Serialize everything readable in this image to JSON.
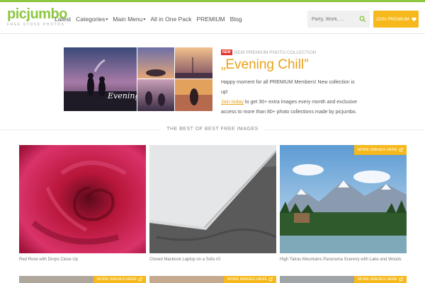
{
  "header": {
    "logo": "picjumbo",
    "tagline": "FREE STOCK PHOTOS",
    "nav": [
      "Latest",
      "Categories",
      "Main Menu",
      "All in One Pack",
      "PREMIUM",
      "Blog"
    ],
    "search_placeholder": "Party, Work, ...",
    "join_label": "JOIN PREMIUM"
  },
  "banner": {
    "badge": "NEW",
    "tag": "NEW PREMIUM PHOTO COLLECTION",
    "title": "„Evening Chill”",
    "text_1": "Happy moment for all PREMIUM Members! New collection is up!",
    "link": "Join today",
    "text_2": " to get 30+ extra images every month and exclusive access to more than 80+ photo collections made by picjumbo.",
    "image_script": "Evening Chill"
  },
  "section": {
    "title": "THE BEST OF BEST FREE IMAGES"
  },
  "cards": [
    {
      "caption": "Red Rose with Drops Close Up"
    },
    {
      "caption": "Closed Macbook Laptop on a Sofa #2"
    },
    {
      "caption": "High Tatras Mountains Panorama Scenery with Lake and Woods",
      "more_label": "MORE IMAGES HERE"
    }
  ],
  "row2_more_label": "MORE IMAGES HERE",
  "colors": {
    "brand": "#8dc63f",
    "accent": "#f6b81a",
    "title": "#e8a219"
  }
}
